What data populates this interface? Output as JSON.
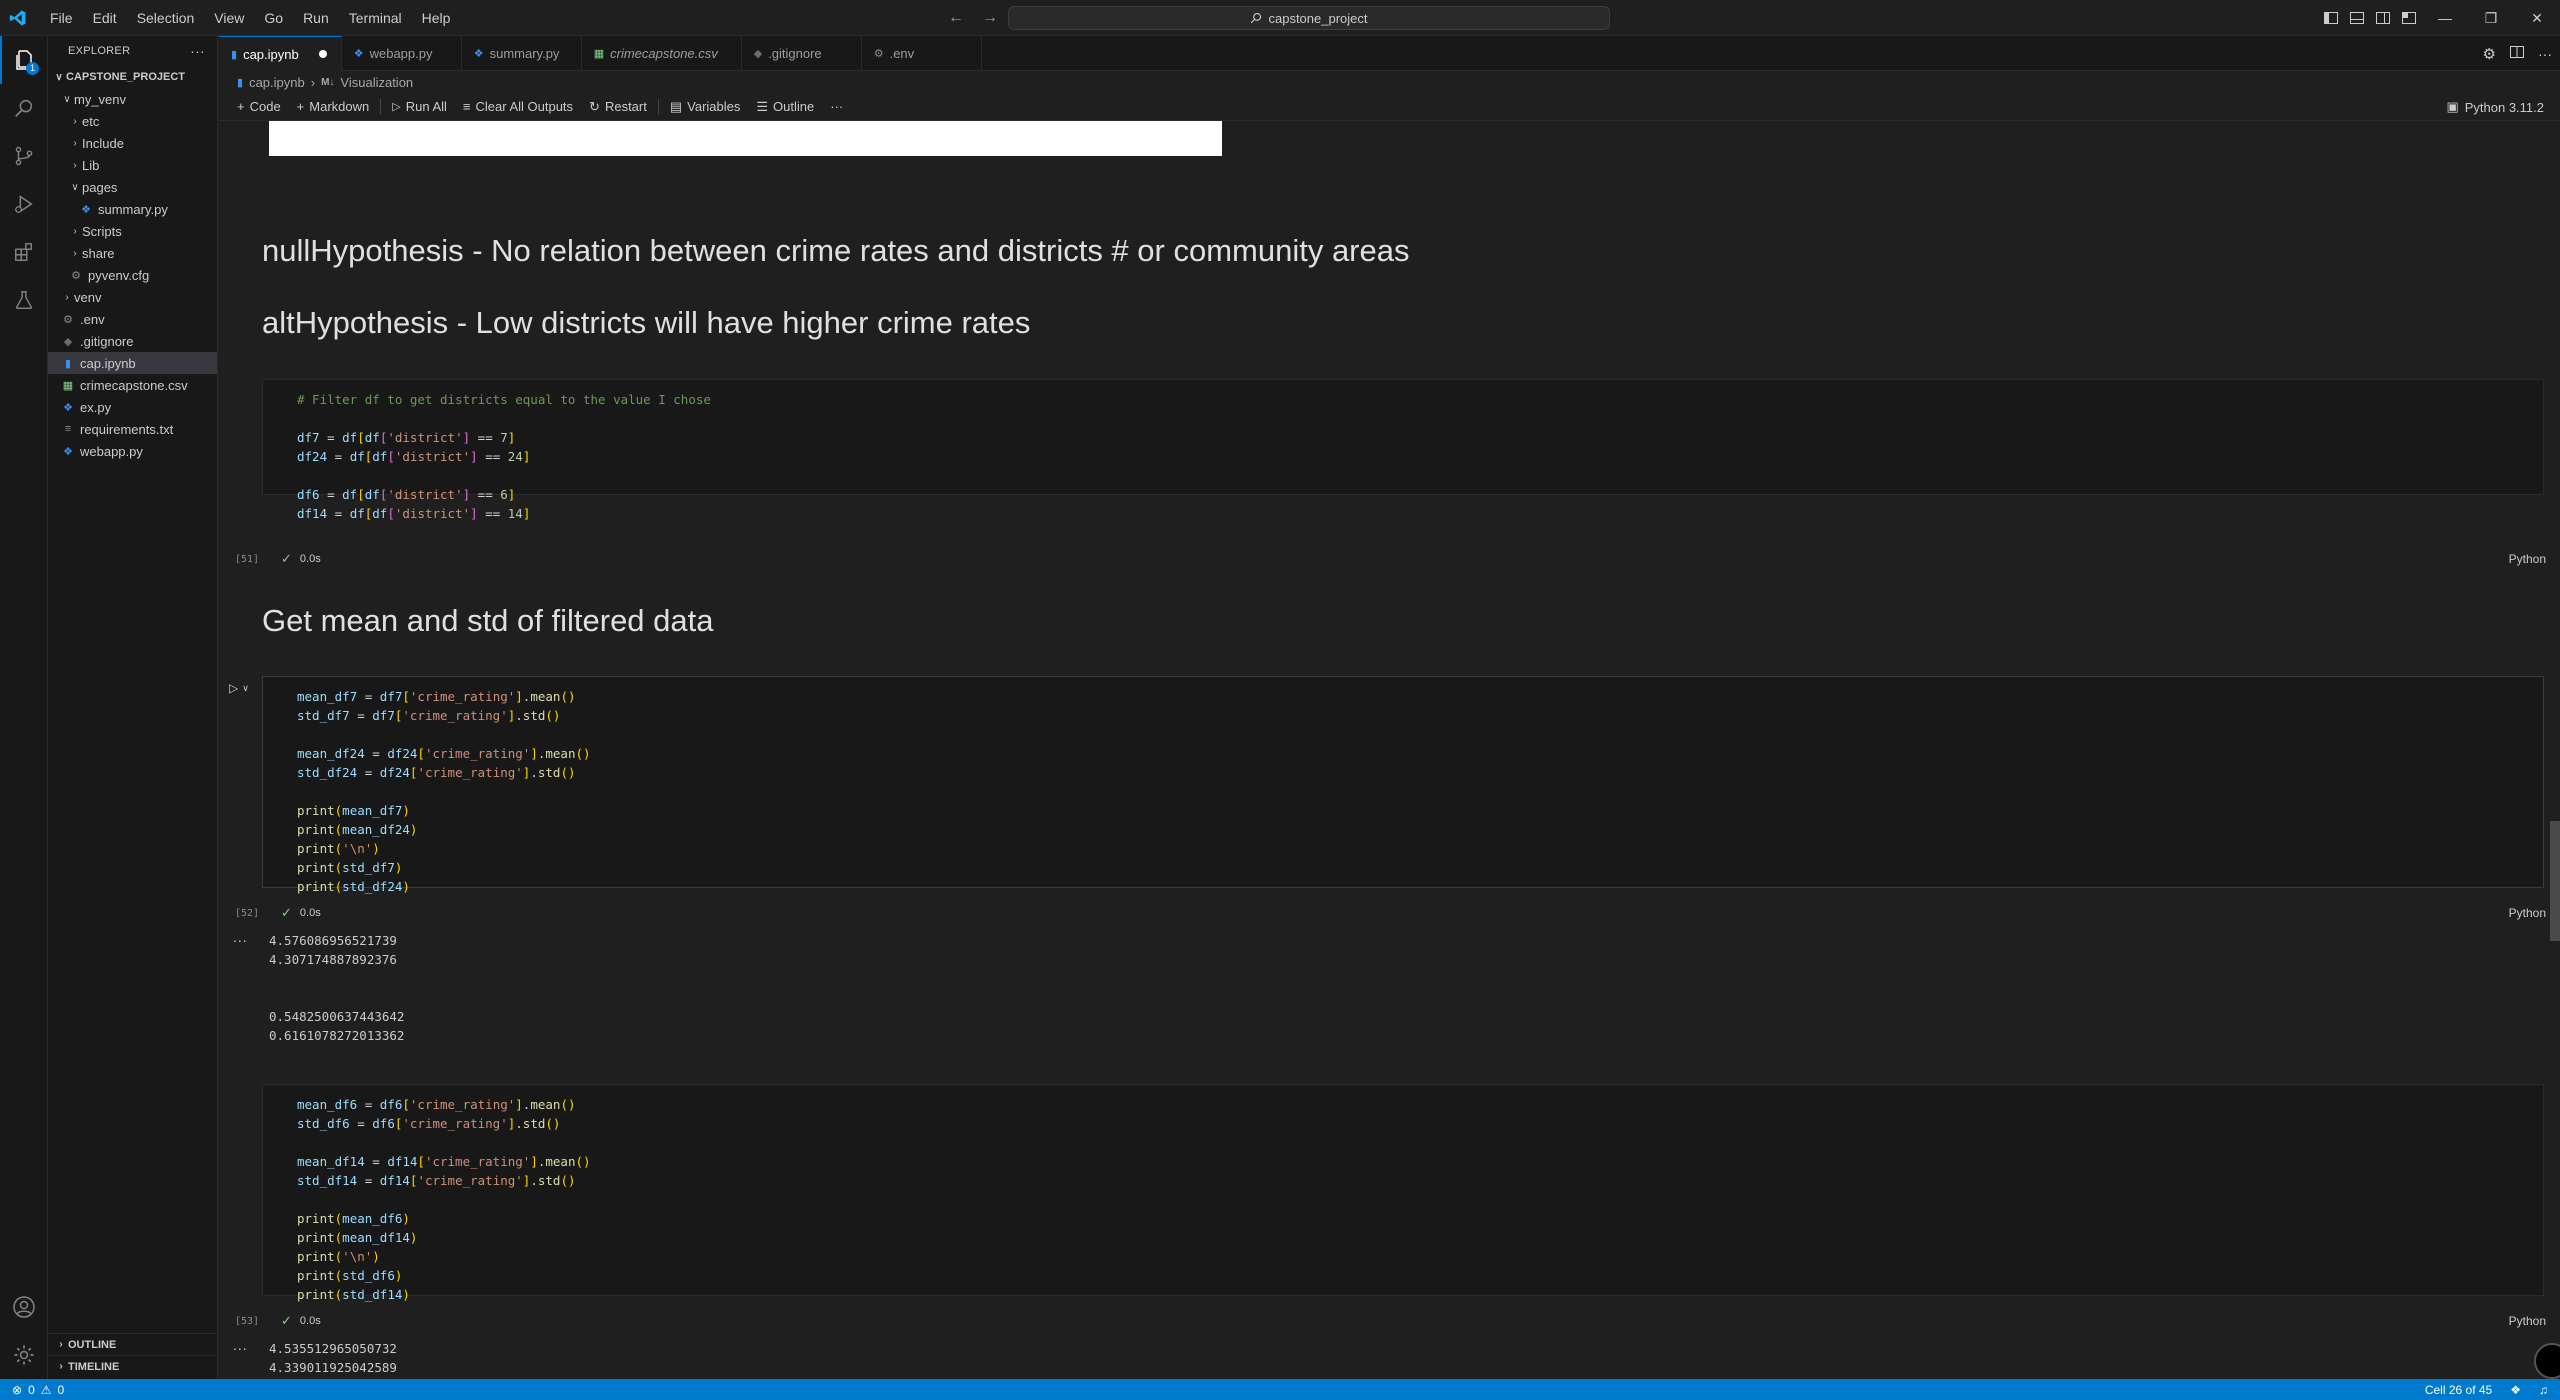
{
  "titlebar": {
    "menu": [
      "File",
      "Edit",
      "Selection",
      "View",
      "Go",
      "Run",
      "Terminal",
      "Help"
    ],
    "search": "capstone_project"
  },
  "sidebar": {
    "title": "EXPLORER",
    "project": "CAPSTONE_PROJECT",
    "items": [
      {
        "label": "my_venv",
        "kind": "folder-open"
      },
      {
        "label": "etc",
        "kind": "folder"
      },
      {
        "label": "Include",
        "kind": "folder"
      },
      {
        "label": "Lib",
        "kind": "folder"
      },
      {
        "label": "pages",
        "kind": "folder-open"
      },
      {
        "label": "summary.py",
        "kind": "python"
      },
      {
        "label": "Scripts",
        "kind": "folder"
      },
      {
        "label": "share",
        "kind": "folder"
      },
      {
        "label": "pyvenv.cfg",
        "kind": "gear"
      },
      {
        "label": "venv",
        "kind": "folder"
      },
      {
        "label": ".env",
        "kind": "gear"
      },
      {
        "label": ".gitignore",
        "kind": "git"
      },
      {
        "label": "cap.ipynb",
        "kind": "notebook"
      },
      {
        "label": "crimecapstone.csv",
        "kind": "csv"
      },
      {
        "label": "ex.py",
        "kind": "python"
      },
      {
        "label": "requirements.txt",
        "kind": "text"
      },
      {
        "label": "webapp.py",
        "kind": "python"
      }
    ],
    "outline": "OUTLINE",
    "timeline": "TIMELINE"
  },
  "tabs": [
    {
      "label": "cap.ipynb",
      "active": true,
      "dirty": true
    },
    {
      "label": "webapp.py"
    },
    {
      "label": "summary.py"
    },
    {
      "label": "crimecapstone.csv"
    },
    {
      "label": ".gitignore"
    },
    {
      "label": ".env"
    }
  ],
  "breadcrumb": {
    "file": "cap.ipynb",
    "section": "Visualization",
    "section_prefix": "M↓"
  },
  "toolbar": {
    "code": "Code",
    "markdown": "Markdown",
    "run_all": "Run All",
    "clear_outputs": "Clear All Outputs",
    "restart": "Restart",
    "variables": "Variables",
    "outline": "Outline",
    "kernel": "Python 3.11.2"
  },
  "notebook": {
    "md1": "nullHypothesis - No relation between crime rates and districts # or community areas",
    "md2": "altHypothesis - Low districts will have higher crime rates",
    "md3": "Get mean and std of filtered data",
    "cell51": {
      "count": "[51]",
      "time": "0.0s",
      "lang": "Python"
    },
    "cell52": {
      "count": "[52]",
      "time": "0.0s",
      "lang": "Python",
      "output": [
        "4.576086956521739",
        "4.307174887892376",
        "",
        "",
        "0.5482500637443642",
        "0.6161078272013362"
      ]
    },
    "cell53": {
      "count": "[53]",
      "time": "0.0s",
      "lang": "Python",
      "output": [
        "4.535512965050732",
        "4.339011925042589"
      ]
    },
    "ellipsis": "..."
  },
  "statusbar": {
    "errors": "0",
    "warnings": "0",
    "cell_position": "Cell 26 of 45"
  }
}
